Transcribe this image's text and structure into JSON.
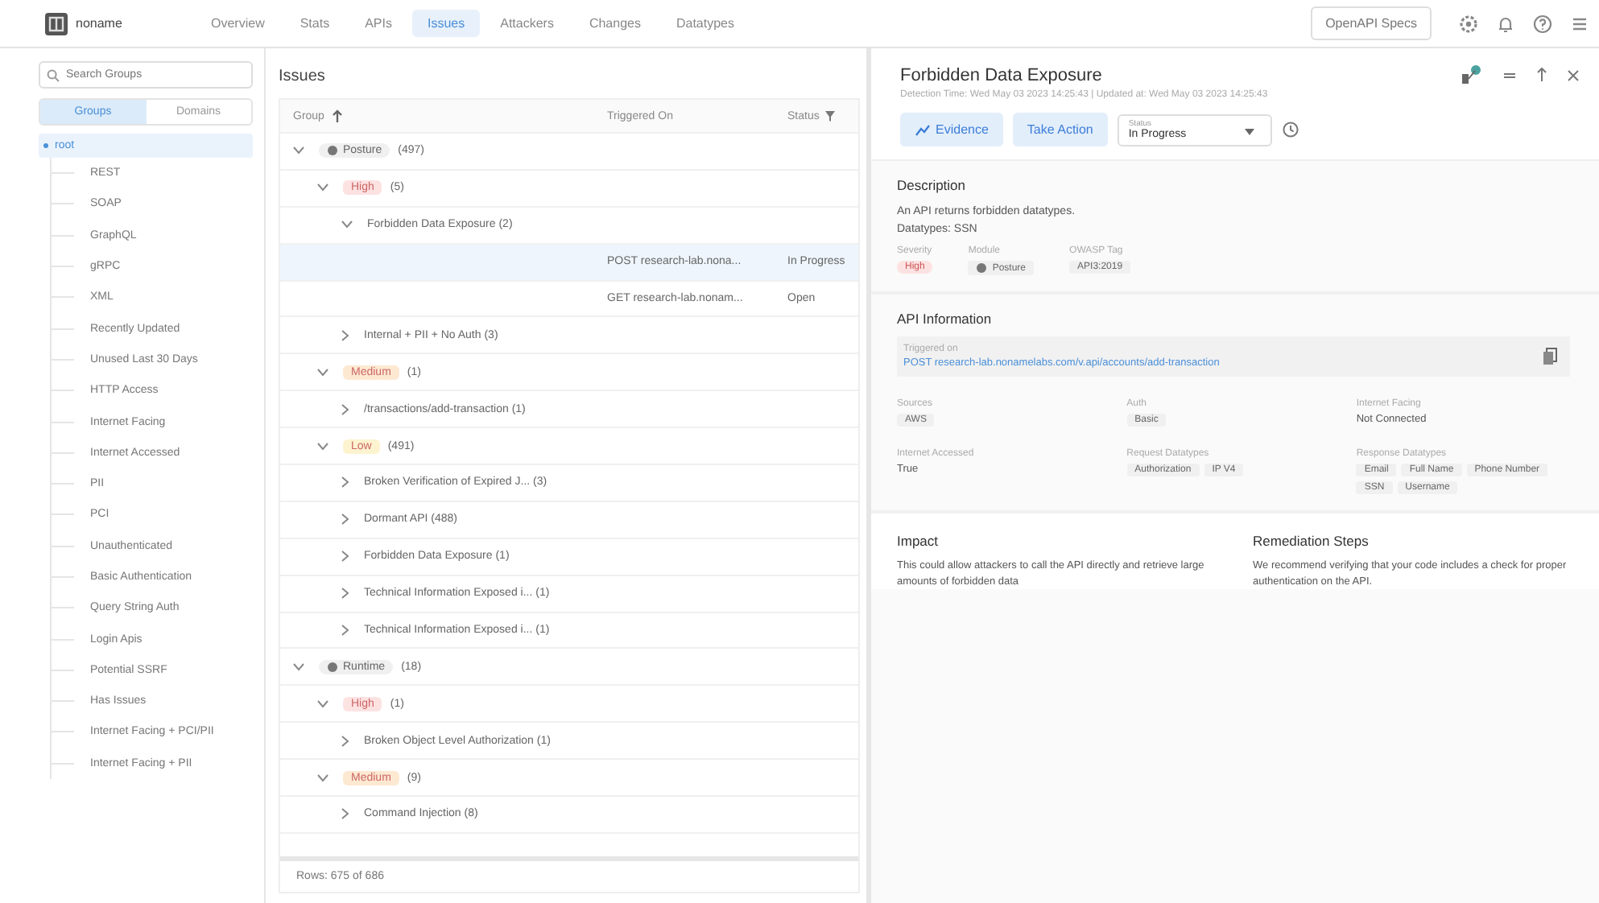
{
  "nav": {
    "logo": "noname",
    "tabs": [
      {
        "label": "Overview",
        "selected": false
      },
      {
        "label": "Stats",
        "selected": false
      },
      {
        "label": "APIs",
        "selected": false
      },
      {
        "label": "Issues",
        "selected": true
      },
      {
        "label": "Attackers",
        "selected": false
      },
      {
        "label": "Changes",
        "selected": false
      },
      {
        "label": "Datatypes",
        "selected": false
      }
    ],
    "specs_button": "OpenAPI Specs"
  },
  "sidebar": {
    "search": {
      "placeholder": "Search Groups"
    },
    "toggle": [
      {
        "label": "Groups",
        "selected": true
      },
      {
        "label": "Domains",
        "selected": false
      }
    ],
    "tree": [
      {
        "label": "root",
        "selected": true,
        "expanded": true,
        "children": [
          {
            "label": "REST"
          },
          {
            "label": "SOAP"
          },
          {
            "label": "GraphQL"
          },
          {
            "label": "gRPC"
          },
          {
            "label": "XML"
          },
          {
            "label": "Recently Updated"
          },
          {
            "label": "Unused Last 30 Days"
          },
          {
            "label": "HTTP Access"
          },
          {
            "label": "Internet Facing"
          },
          {
            "label": "Internet Accessed"
          },
          {
            "label": "PII"
          },
          {
            "label": "PCI"
          },
          {
            "label": "Unauthenticated"
          },
          {
            "label": "Basic Authentication"
          },
          {
            "label": "Query String Auth"
          },
          {
            "label": "Login Apis"
          },
          {
            "label": "Potential SSRF"
          },
          {
            "label": "Has Issues"
          },
          {
            "label": "Internet Facing + PCI/PII"
          },
          {
            "label": "Internet Facing + PII"
          }
        ]
      }
    ]
  },
  "issues": {
    "title": "Issues",
    "columns": [
      "Group",
      "Triggered On",
      "Status"
    ],
    "rows": [
      {
        "kind": "module",
        "label": "Posture",
        "count": "(497)",
        "expanded": true,
        "children": [
          {
            "kind": "severity",
            "label": "High",
            "count": "(5)",
            "color": "#fde2e2",
            "expanded": true,
            "children": [
              {
                "kind": "issue",
                "label": "Forbidden Data Exposure (2)",
                "expanded": true,
                "children": [
                  {
                    "kind": "leaf",
                    "triggered_on": "POST research-lab.nona...",
                    "status": "In Progress",
                    "selected": true
                  },
                  {
                    "kind": "leaf",
                    "triggered_on": "GET research-lab.nonam...",
                    "status": "Open",
                    "selected": false
                  }
                ]
              },
              {
                "kind": "issue",
                "label": "Internal + PII + No Auth (3)",
                "expanded": false
              }
            ]
          },
          {
            "kind": "severity",
            "label": "Medium",
            "count": "(1)",
            "color": "#fde9d2",
            "expanded": true,
            "children": [
              {
                "kind": "issue",
                "label": "/transactions/add-transaction (1)",
                "expanded": false
              }
            ]
          },
          {
            "kind": "severity",
            "label": "Low",
            "count": "(491)",
            "color": "#fdf3cf",
            "expanded": true,
            "children": [
              {
                "kind": "issue",
                "label": "Broken Verification of Expired J...  (3)",
                "expanded": false
              },
              {
                "kind": "issue",
                "label": "Dormant API (488)",
                "expanded": false
              },
              {
                "kind": "issue",
                "label": "Forbidden Data Exposure (1)",
                "expanded": false
              },
              {
                "kind": "issue",
                "label": "Technical Information Exposed i...  (1)",
                "expanded": false
              },
              {
                "kind": "issue",
                "label": "Technical Information Exposed i...  (1)",
                "expanded": false
              }
            ]
          }
        ]
      },
      {
        "kind": "module",
        "label": "Runtime",
        "count": "(18)",
        "expanded": true,
        "children": [
          {
            "kind": "severity",
            "label": "High",
            "count": "(1)",
            "color": "#fde2e2",
            "expanded": true,
            "children": [
              {
                "kind": "issue",
                "label": "Broken Object Level Authorization (1)",
                "expanded": false
              }
            ]
          },
          {
            "kind": "severity",
            "label": "Medium",
            "count": "(9)",
            "color": "#fde9d2",
            "expanded": true,
            "children": [
              {
                "kind": "issue",
                "label": "Command Injection (8)",
                "expanded": false
              }
            ]
          }
        ]
      }
    ],
    "footer": "Rows: 675 of 686"
  },
  "detail": {
    "title": "Forbidden Data Exposure",
    "meta": "Detection Time: Wed May 03 2023 14:25:43  |  Updated at: Wed May 03 2023 14:25:43",
    "evidence_button": "Evidence",
    "action_button": "Take Action",
    "status": {
      "label": "Status",
      "value": "In Progress"
    },
    "description": {
      "heading": "Description",
      "lines": [
        "An API returns forbidden datatypes.",
        "Datatypes: SSN"
      ],
      "fields": [
        {
          "label": "Severity",
          "value": "High",
          "kind": "severity"
        },
        {
          "label": "Module",
          "value": "Posture",
          "kind": "module"
        },
        {
          "label": "OWASP Tag",
          "value": "API3:2019",
          "kind": "tag"
        }
      ]
    },
    "api": {
      "heading": "API Information",
      "triggered_label": "Triggered on",
      "triggered_value": "POST research-lab.nonamelabs.com/v.api/accounts/add-transaction",
      "fields": [
        {
          "label": "Sources",
          "values": [
            "AWS"
          ],
          "kind": "tags"
        },
        {
          "label": "Auth",
          "values": [
            "Basic"
          ],
          "kind": "tags"
        },
        {
          "label": "Internet Facing",
          "values": [
            "Not Connected"
          ],
          "kind": "text"
        },
        {
          "label": "Internet Accessed",
          "values": [
            "True"
          ],
          "kind": "text"
        },
        {
          "label": "Request Datatypes",
          "values": [
            "Authorization",
            "IP V4"
          ],
          "kind": "tags"
        },
        {
          "label": "Response Datatypes",
          "values": [
            "Email",
            "Full Name",
            "Phone Number",
            "SSN",
            "Username"
          ],
          "kind": "tags"
        }
      ]
    },
    "impact": {
      "heading": "Impact",
      "text": "This could allow attackers to call the API directly and retrieve large amounts of forbidden data"
    },
    "remediation": {
      "heading": "Remediation Steps",
      "text": "We recommend verifying that your code includes a check for proper authentication on the API."
    }
  }
}
